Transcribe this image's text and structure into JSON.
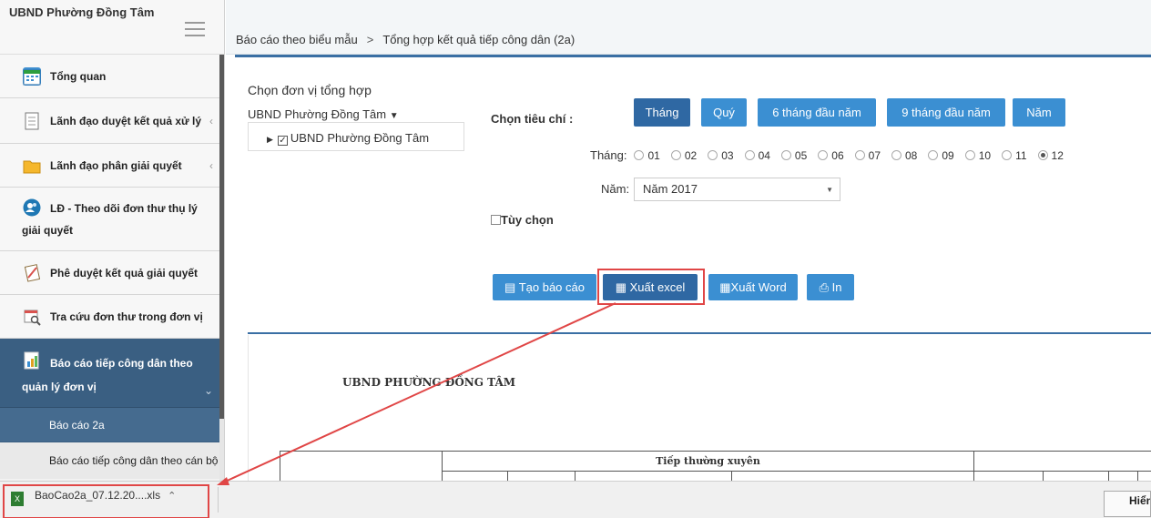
{
  "sidebar": {
    "brand": "UBND Phường Đồng Tâm",
    "items": [
      {
        "label": "Tổng quan",
        "icon": "calendar-icon"
      },
      {
        "label": "Lãnh đạo duyệt kết quả xử lý",
        "icon": "document-icon"
      },
      {
        "label": "Lãnh đạo phân giải quyết",
        "icon": "folder-icon"
      },
      {
        "label": "LĐ - Theo dõi đơn thư thụ lý",
        "label2": "giải quyết",
        "icon": "people-icon"
      },
      {
        "label": "Phê duyệt kết quả giải quyết",
        "icon": "clipboard-icon"
      },
      {
        "label": "Tra cứu đơn thư trong đơn vị",
        "icon": "search-calendar-icon"
      },
      {
        "label": "Báo cáo tiếp công dân theo",
        "label2": "quản lý đơn vị",
        "icon": "report-icon"
      }
    ],
    "subitems": [
      "Báo cáo 2a",
      "Báo cáo tiếp công dân theo cán bộ"
    ]
  },
  "breadcrumb": {
    "parent": "Báo cáo theo biểu mẫu",
    "separator": ">",
    "current": "Tổng hợp kết quả tiếp công dân (2a)"
  },
  "form": {
    "unit_heading": "Chọn đơn vị tổng hợp",
    "unit_select": "UBND Phường Đồng Tâm",
    "unit_tree_item": "UBND Phường Đồng Tâm",
    "criteria_label": "Chọn tiêu chí :",
    "period_buttons": [
      "Tháng",
      "Quý",
      "6 tháng đầu năm",
      "9 tháng đầu năm",
      "Năm"
    ],
    "month_label": "Tháng:",
    "months": [
      "01",
      "02",
      "03",
      "04",
      "05",
      "06",
      "07",
      "08",
      "09",
      "10",
      "11",
      "12"
    ],
    "selected_month": "12",
    "year_label": "Năm:",
    "year_value": "Năm 2017",
    "option_label": "Tùy chọn",
    "actions": {
      "create": "Tạo báo cáo",
      "excel": "Xuất excel",
      "word": "Xuất Word",
      "print": "In"
    }
  },
  "report": {
    "title": "UBND PHƯỜNG ĐỒNG TÂM",
    "col_header": "Tiếp thường xuyên"
  },
  "download": {
    "filename": "BaoCao2a_07.12.20....xls",
    "show_all": "Hiển"
  },
  "colors": {
    "sidebar_active": "#3a5f82",
    "primary_button": "#3b8fd2",
    "highlight": "#e04646"
  }
}
